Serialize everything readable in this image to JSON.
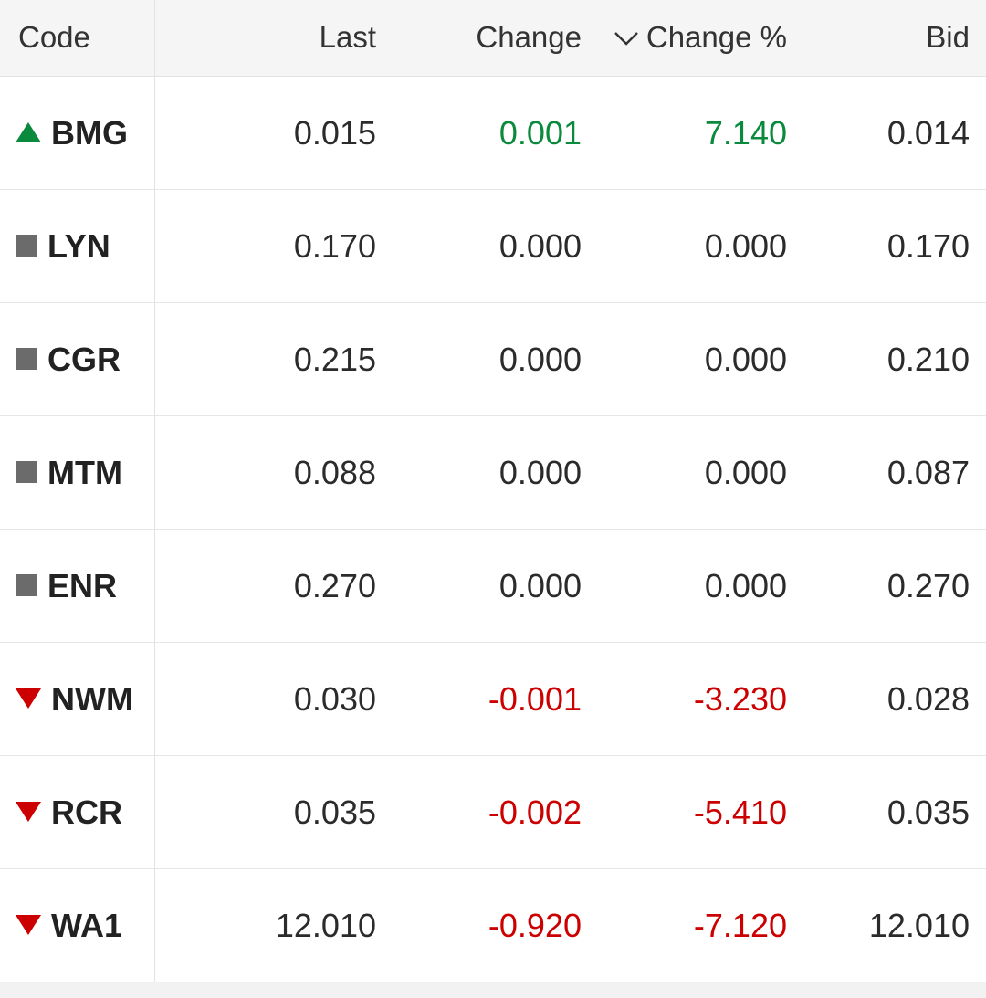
{
  "header": {
    "code": "Code",
    "last": "Last",
    "change": "Change",
    "change_pct": "Change %",
    "bid": "Bid",
    "sort_icon": "chevron-down-icon"
  },
  "colors": {
    "up": "#0a8a3c",
    "down": "#cc0000",
    "neutral_icon": "#6b6b6b"
  },
  "rows": [
    {
      "code": "BMG",
      "trend": "up",
      "last": "0.015",
      "change": "0.001",
      "change_pct": "7.140",
      "bid": "0.014"
    },
    {
      "code": "LYN",
      "trend": "flat",
      "last": "0.170",
      "change": "0.000",
      "change_pct": "0.000",
      "bid": "0.170"
    },
    {
      "code": "CGR",
      "trend": "flat",
      "last": "0.215",
      "change": "0.000",
      "change_pct": "0.000",
      "bid": "0.210"
    },
    {
      "code": "MTM",
      "trend": "flat",
      "last": "0.088",
      "change": "0.000",
      "change_pct": "0.000",
      "bid": "0.087"
    },
    {
      "code": "ENR",
      "trend": "flat",
      "last": "0.270",
      "change": "0.000",
      "change_pct": "0.000",
      "bid": "0.270"
    },
    {
      "code": "NWM",
      "trend": "down",
      "last": "0.030",
      "change": "-0.001",
      "change_pct": "-3.230",
      "bid": "0.028"
    },
    {
      "code": "RCR",
      "trend": "down",
      "last": "0.035",
      "change": "-0.002",
      "change_pct": "-5.410",
      "bid": "0.035"
    },
    {
      "code": "WA1",
      "trend": "down",
      "last": "12.010",
      "change": "-0.920",
      "change_pct": "-7.120",
      "bid": "12.010"
    }
  ]
}
